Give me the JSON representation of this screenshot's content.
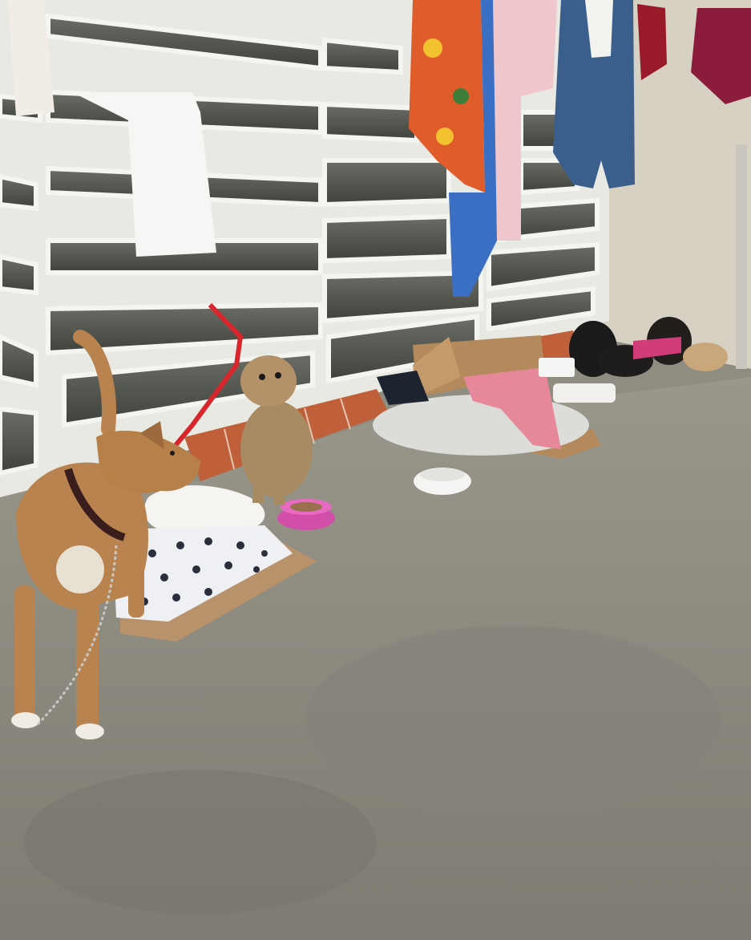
{
  "scene": {
    "colors": {
      "ground": "#8d8a80",
      "ground_dark": "#6f6c63",
      "wall": "#d8d2c6",
      "window_frame": "#eeeeea",
      "window_glass": "#5a5c55",
      "brick": "#c0603a",
      "tan_dog": "#b9834f",
      "terrier": "#a88a63",
      "pink_bowl": "#d24fa8",
      "white_bowl": "#f4f4f2",
      "cardboard": "#b48a5c",
      "red_leash": "#d8262c",
      "blanket_pink": "#e7889a",
      "pillow": "#dcdcd8"
    },
    "elements": [
      "louvered-window-wall",
      "hanging-laundry",
      "tan-dog-on-chain",
      "terrier-on-red-leash",
      "white-dog-lying",
      "pink-food-bowl",
      "white-water-bowl",
      "cardboard-box",
      "pillow-bed",
      "black-dogs-resting"
    ]
  }
}
